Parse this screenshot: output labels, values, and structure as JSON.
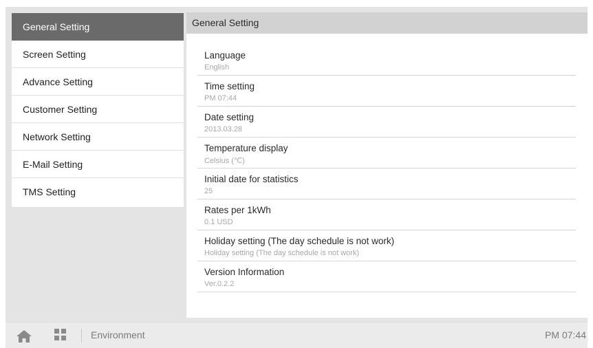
{
  "sidebar": {
    "items": [
      {
        "label": "General Setting",
        "active": true
      },
      {
        "label": "Screen Setting"
      },
      {
        "label": "Advance Setting"
      },
      {
        "label": "Customer Setting"
      },
      {
        "label": "Network Setting"
      },
      {
        "label": "E-Mail Setting"
      },
      {
        "label": "TMS Setting"
      }
    ]
  },
  "panel": {
    "title": "General Setting",
    "rows": [
      {
        "title": "Language",
        "value": "English"
      },
      {
        "title": "Time setting",
        "value": "PM 07:44"
      },
      {
        "title": "Date setting",
        "value": "2013.03.28"
      },
      {
        "title": "Temperature display",
        "value": "Celsius (℃)"
      },
      {
        "title": "Initial date for statistics",
        "value": "25"
      },
      {
        "title": "Rates per 1kWh",
        "value": "0.1 USD"
      },
      {
        "title": "Holiday setting (The day schedule is not work)",
        "value": "Holiday setting (The day schedule is not work)"
      },
      {
        "title": "Version Information",
        "value": "Ver.0.2.2"
      }
    ]
  },
  "bottombar": {
    "home_icon": "home-icon",
    "apps_icon": "apps-grid-icon",
    "location": "Environment",
    "clock": "PM 07:44"
  },
  "colors": {
    "active_item_bg": "#6a6a6a",
    "header_bg": "#d2d2d2",
    "screen_bg": "#e4e4e4"
  }
}
